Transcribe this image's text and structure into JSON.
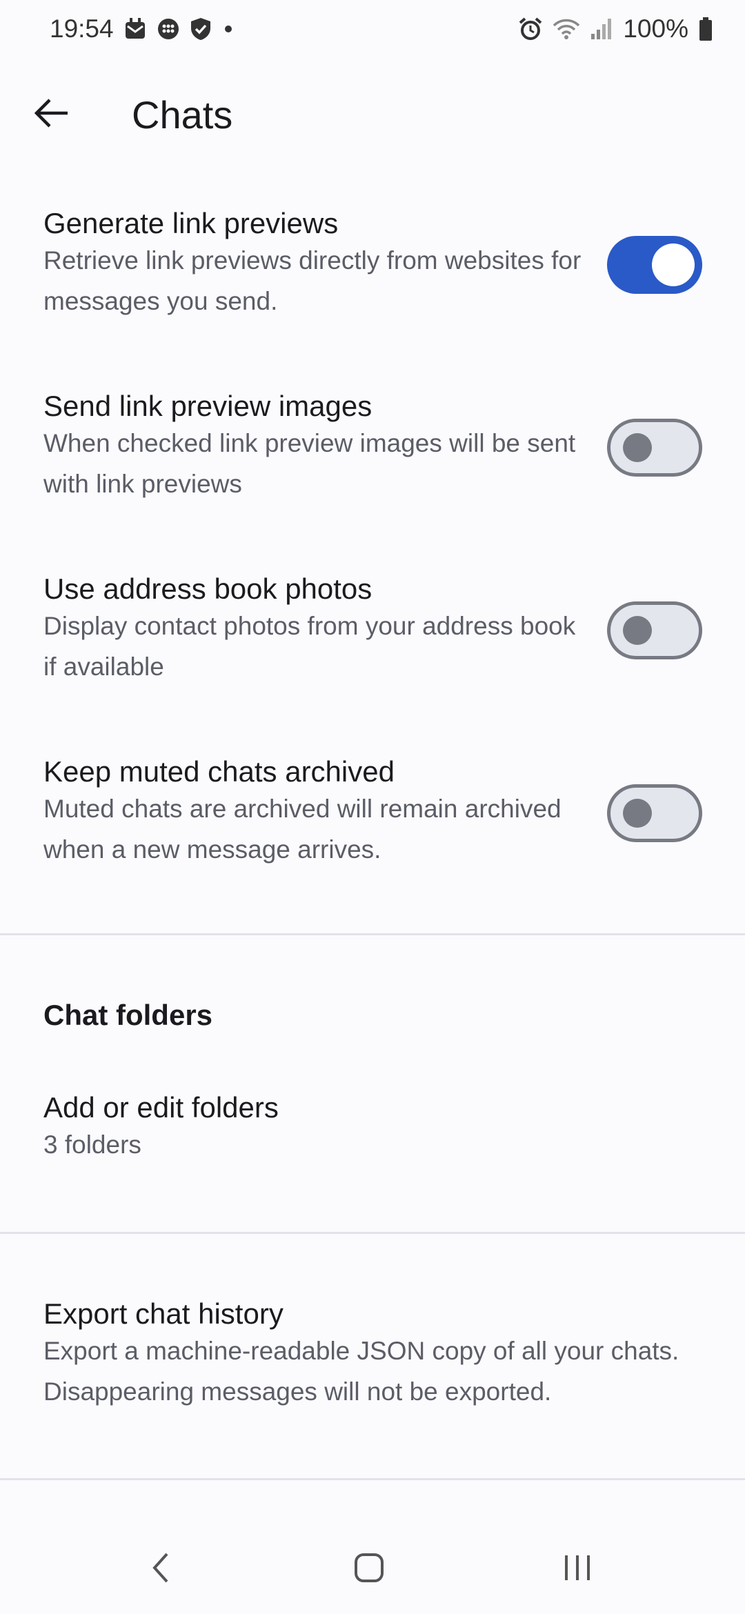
{
  "status_bar": {
    "time": "19:54",
    "battery": "100%",
    "icons_left": [
      "mail-notification-icon",
      "chat-bubble-icon",
      "shield-icon",
      "dot-icon"
    ],
    "icons_right": [
      "alarm-icon",
      "wifi-icon",
      "signal-icon",
      "battery-icon"
    ]
  },
  "app_bar": {
    "title": "Chats",
    "back_icon": "arrow-left-icon"
  },
  "settings": [
    {
      "title": "Generate link previews",
      "description": "Retrieve link previews directly from websites for messages you send.",
      "enabled": true
    },
    {
      "title": "Send link preview images",
      "description": "When checked link preview images will be sent with link previews",
      "enabled": false
    },
    {
      "title": "Use address book photos",
      "description": "Display contact photos from your address book if available",
      "enabled": false
    },
    {
      "title": "Keep muted chats archived",
      "description": "Muted chats are archived will remain archived when a new message arrives.",
      "enabled": false
    }
  ],
  "chat_folders": {
    "header": "Chat folders",
    "item_title": "Add or edit folders",
    "item_subtitle": "3 folders"
  },
  "export": {
    "title": "Export chat history",
    "description": "Export a machine-readable JSON copy of all your chats. Disappearing messages will not be exported."
  },
  "colors": {
    "accent": "#2a5ac8",
    "background": "#fbfbfe",
    "text_primary": "#1b1b1f",
    "text_secondary": "#5b5d66"
  },
  "nav_bar": {
    "buttons": [
      "back-nav-icon",
      "home-nav-icon",
      "recents-nav-icon"
    ]
  }
}
